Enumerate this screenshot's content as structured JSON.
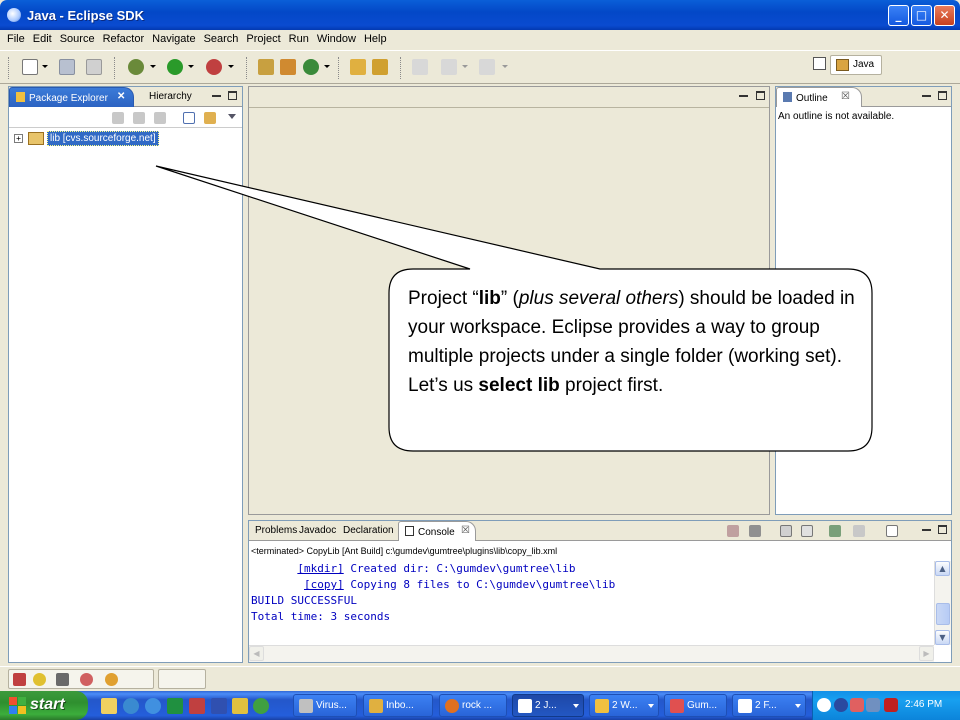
{
  "window": {
    "title": "Java - Eclipse SDK",
    "min": "_",
    "max": "□",
    "close": "✕"
  },
  "menu": [
    "File",
    "Edit",
    "Source",
    "Refactor",
    "Navigate",
    "Search",
    "Project",
    "Run",
    "Window",
    "Help"
  ],
  "perspective": {
    "label": "Java"
  },
  "package_explorer": {
    "tab_label": "Package Explorer",
    "tab_close": "✕",
    "hierarchy_tab": "Hierarchy",
    "tree": [
      {
        "expander": "+",
        "label": "lib  [cvs.sourceforge.net]"
      }
    ]
  },
  "outline": {
    "tab_label": "Outline",
    "tab_close": "☒",
    "empty_message": "An outline is not available."
  },
  "bottom_tabs": [
    "Problems",
    "Javadoc",
    "Declaration",
    "Console"
  ],
  "console": {
    "tab_close": "☒",
    "header": "<terminated> CopyLib [Ant Build] c:\\gumdev\\gumtree\\plugins\\lib\\copy_lib.xml",
    "lines": [
      {
        "indent": "       ",
        "task": "[mkdir]",
        "text": " Created dir: C:\\gumdev\\gumtree\\lib"
      },
      {
        "indent": "        ",
        "task": "[copy]",
        "text": " Copying 8 files to C:\\gumdev\\gumtree\\lib"
      },
      {
        "indent": "",
        "task": "",
        "text": "BUILD SUCCESSFUL"
      },
      {
        "indent": "",
        "task": "",
        "text": "Total time: 3 seconds"
      }
    ]
  },
  "callout": {
    "parts": [
      {
        "t": "Project “",
        "s": ""
      },
      {
        "t": "lib",
        "s": "b"
      },
      {
        "t": "” (",
        "s": ""
      },
      {
        "t": "plus several others",
        "s": "i"
      },
      {
        "t": ") should be loaded in your workspace.  Eclipse provides a way to group multiple projects under a single folder (working set).  Let’s us ",
        "s": ""
      },
      {
        "t": "select lib",
        "s": "b"
      },
      {
        "t": " project first.",
        "s": ""
      }
    ]
  },
  "taskbar": {
    "start_label": "start",
    "buttons": [
      {
        "label": "Virus...",
        "icon_color": "#c0c0c0",
        "active": false,
        "dropdown": false
      },
      {
        "label": "Inbo...",
        "icon_color": "#e0b040",
        "active": false,
        "dropdown": false
      },
      {
        "label": "rock ...",
        "icon_color": "#e07020",
        "active": false,
        "dropdown": false
      },
      {
        "label": "2 J...",
        "icon_color": "#ffffff",
        "active": true,
        "dropdown": true
      },
      {
        "label": "2 W...",
        "icon_color": "#f0c040",
        "active": false,
        "dropdown": true
      },
      {
        "label": "Gum...",
        "icon_color": "#e05050",
        "active": false,
        "dropdown": false
      },
      {
        "label": "2 F...",
        "icon_color": "#ffffff",
        "active": false,
        "dropdown": true
      }
    ],
    "clock": "2:46 PM"
  },
  "colors": {
    "accent": "#316ac5",
    "console_text": "#0000c0",
    "taskbar": "#245edb",
    "start": "#3cae3c"
  }
}
